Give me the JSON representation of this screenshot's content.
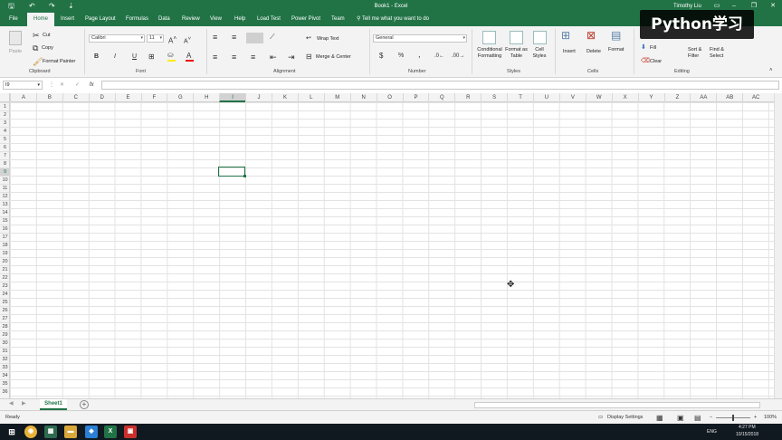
{
  "window": {
    "title": "Book1  -  Excel",
    "user": "Timothy Liu"
  },
  "qat": {
    "save_icon": "save-icon",
    "undo_icon": "undo-icon",
    "redo_icon": "redo-icon",
    "customize_icon": "customize-icon"
  },
  "window_controls": {
    "minimize": "–",
    "restore": "❐",
    "close": "✕",
    "ribbon_display": "▭"
  },
  "tabs": [
    "File",
    "Home",
    "Insert",
    "Page Layout",
    "Formulas",
    "Data",
    "Review",
    "View",
    "Help",
    "Load Test",
    "Power Pivot",
    "Team"
  ],
  "tellme": "Tell me what you want to do",
  "watermark": "Python学习",
  "ribbon": {
    "clipboard": {
      "label": "Clipboard",
      "paste": "Paste",
      "cut": "Cut",
      "copy": "Copy",
      "format_painter": "Format Painter"
    },
    "font": {
      "label": "Font",
      "name": "Calibri",
      "size": "11",
      "bold": "B",
      "italic": "I",
      "underline": "U"
    },
    "alignment": {
      "label": "Alignment",
      "wrap_text": "Wrap Text",
      "merge_center": "Merge & Center"
    },
    "number": {
      "label": "Number",
      "format": "General",
      "currency": "$",
      "percent": "%",
      "comma": ","
    },
    "styles": {
      "label": "Styles",
      "conditional_formatting": "Conditional Formatting",
      "format_as_table": "Format as Table",
      "cell_styles": "Cell Styles"
    },
    "cells": {
      "label": "Cells",
      "insert": "Insert",
      "delete": "Delete",
      "format": "Format"
    },
    "editing": {
      "label": "Editing",
      "fill": "Fill",
      "clear": "Clear",
      "sort_filter": "Sort & Filter",
      "find_select": "Find & Select"
    }
  },
  "formula_bar": {
    "name_box": "I9",
    "fx": "fx",
    "value": ""
  },
  "columns": [
    "A",
    "B",
    "C",
    "D",
    "E",
    "F",
    "G",
    "H",
    "I",
    "J",
    "K",
    "L",
    "M",
    "N",
    "O",
    "P",
    "Q",
    "R",
    "S",
    "T",
    "U",
    "V",
    "W",
    "X",
    "Y",
    "Z",
    "AA",
    "AB",
    "AC"
  ],
  "rows": [
    "1",
    "2",
    "3",
    "4",
    "5",
    "6",
    "7",
    "8",
    "9",
    "10",
    "11",
    "12",
    "13",
    "14",
    "15",
    "16",
    "17",
    "18",
    "19",
    "20",
    "21",
    "22",
    "23",
    "24",
    "25",
    "26",
    "27",
    "28",
    "29",
    "30",
    "31",
    "32",
    "33",
    "34",
    "35",
    "36"
  ],
  "selected": {
    "column": "I",
    "row": "9"
  },
  "sheets": [
    "Sheet1"
  ],
  "status": {
    "ready": "Ready",
    "display_settings": "Display Settings",
    "zoom": "100%"
  },
  "taskbar": {
    "time": "4:27 PM",
    "date": "10/15/2018",
    "lang": "ENG"
  }
}
